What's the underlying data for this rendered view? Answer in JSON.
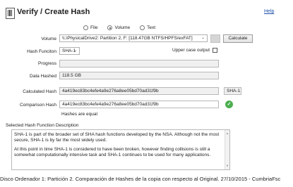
{
  "window": {
    "title": "Verify / Create Hash",
    "help_link": "Help"
  },
  "source": {
    "options": [
      {
        "label": "File",
        "selected": false
      },
      {
        "label": "Volume",
        "selected": true
      },
      {
        "label": "Text",
        "selected": false
      }
    ]
  },
  "volume": {
    "label": "Volume",
    "value": "\\\\.\\PhysicalDrive2: Partition 2, F: [118.47GB NTFS/HPFS/exFAT]",
    "calculate_label": "Calculate"
  },
  "hash_function": {
    "label": "Hash Funciton",
    "value": "SHA-1",
    "uppercase_label": "Upper case output",
    "uppercase_checked": false
  },
  "progress": {
    "label": "Progress",
    "fraction": 0
  },
  "data_hashed": {
    "label": "Data Hashed",
    "value": "118.5 GB"
  },
  "calculated": {
    "label": "Calculated Hash",
    "value": "4a419ec83bc4efe4a9e276a8ee05bd70ad31f9b",
    "algo": "SHA-1"
  },
  "comparison": {
    "label": "Comparison Hash",
    "value": "4a419ec83bc4efe4a9e276a8ee05bd70ad31f9b",
    "result": "Hashes are equal"
  },
  "description": {
    "title": "Selected Hash Function Description",
    "p1": "SHA-1 is part of the broader set of SHA hash functions developed by the NSA. Although not the most secure, SHA-1 is by far the most widely used.",
    "p2": "At this point in time SHA-1 is considered to have been broken, however finding collisions is still a somewhat computationally intensive task and SHA-1 continues to be used for many applications."
  },
  "caption": "Disco Ordenador 1: Partición 2. Comparación de Hashes de la copia con respecto al Original. 27/10/2015 - CumbriaFsc"
}
